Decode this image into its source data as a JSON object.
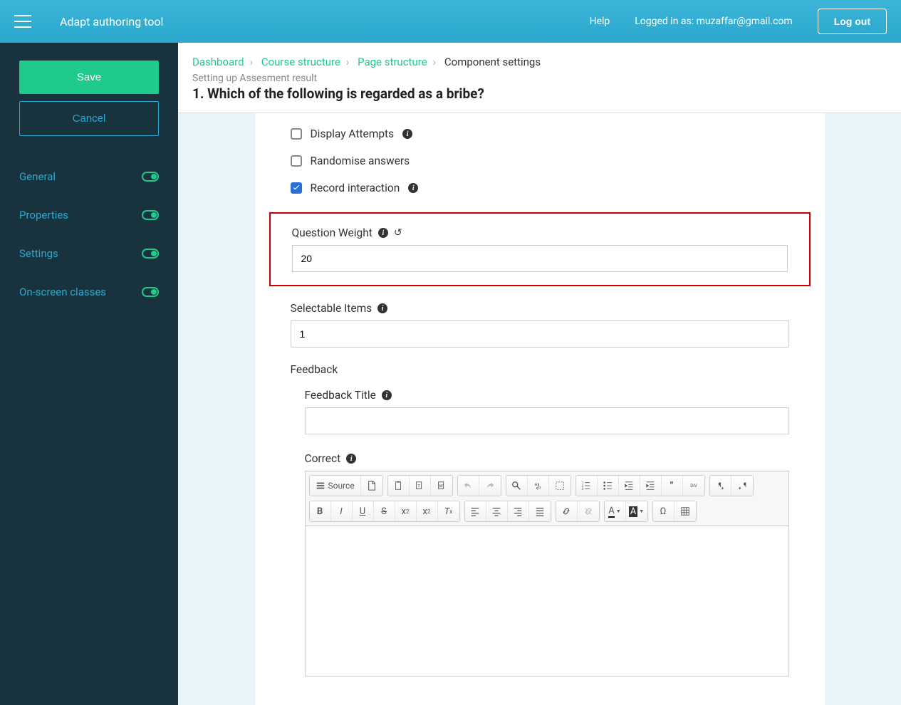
{
  "topbar": {
    "app_title": "Adapt authoring tool",
    "help": "Help",
    "logged_in": "Logged in as: muzaffar@gmail.com",
    "logout": "Log out"
  },
  "sidebar": {
    "save": "Save",
    "cancel": "Cancel",
    "nav": [
      {
        "label": "General"
      },
      {
        "label": "Properties"
      },
      {
        "label": "Settings"
      },
      {
        "label": "On-screen classes"
      }
    ]
  },
  "breadcrumbs": {
    "items": [
      "Dashboard",
      "Course structure",
      "Page structure"
    ],
    "current": "Component settings"
  },
  "subtitle": "Setting up Assesment result",
  "page_title": "1. Which of the following is regarded as a bribe?",
  "form": {
    "display_attempts": {
      "label": "Display Attempts",
      "checked": false
    },
    "randomise": {
      "label": "Randomise answers",
      "checked": false
    },
    "record_interaction": {
      "label": "Record interaction",
      "checked": true
    },
    "question_weight": {
      "label": "Question Weight",
      "value": "20"
    },
    "selectable_items": {
      "label": "Selectable Items",
      "value": "1"
    },
    "feedback": {
      "label": "Feedback",
      "title_label": "Feedback Title",
      "title_value": "",
      "correct_label": "Correct"
    }
  },
  "rte": {
    "source": "Source"
  }
}
